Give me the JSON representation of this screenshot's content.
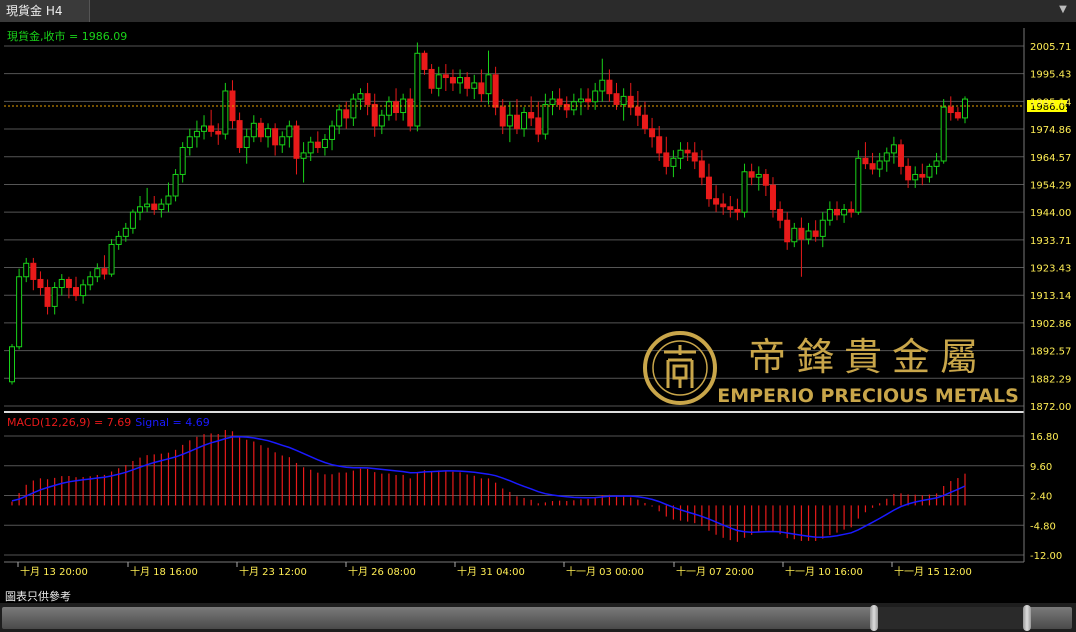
{
  "tab": {
    "label": "現貨金 H4"
  },
  "price_label": "現貨金,收市 = 1986.09",
  "macd_label": "MACD(12,26,9) = 7.69",
  "signal_label": "Signal = 4.69",
  "logo": {
    "chinese": "帝鋒貴金屬",
    "english": "EMPERIO PRECIOUS METALS"
  },
  "disclaimer": "圖表只供參考",
  "colors": {
    "up": "#19d219",
    "down": "#e81a1a",
    "signal": "#1a1aff",
    "macd_hist": "#e81a1a",
    "current_price_line": "#e8a000",
    "current_price_box": "#ffff00",
    "axis_text": "#ffee55",
    "logo": "#c9a64a"
  },
  "chart_data": [
    {
      "type": "candlestick",
      "title": "現貨金 H4",
      "close_label": "1986.09",
      "ylim": [
        1872.0,
        2010.0
      ],
      "y_ticks": [
        "2005.71",
        "1995.43",
        "1985.14",
        "1974.86",
        "1964.57",
        "1954.29",
        "1944.00",
        "1933.71",
        "1923.43",
        "1913.14",
        "1902.86",
        "1892.57",
        "1882.29",
        "1872.00"
      ],
      "x_ticks": [
        "十月 13 20:00",
        "十月 18 16:00",
        "十月 23 12:00",
        "十月 26 08:00",
        "十月 31 04:00",
        "十一月 03 00:00",
        "十一月 07 20:00",
        "十一月 10 16:00",
        "十一月 15 12:00"
      ],
      "grid": true,
      "candles": [
        [
          1881,
          1895,
          1880,
          1894
        ],
        [
          1894,
          1923,
          1893,
          1920
        ],
        [
          1920,
          1927,
          1918,
          1925
        ],
        [
          1925,
          1927,
          1915,
          1919
        ],
        [
          1919,
          1922,
          1913,
          1916
        ],
        [
          1916,
          1919,
          1906,
          1909
        ],
        [
          1909,
          1918,
          1906,
          1916
        ],
        [
          1916,
          1921,
          1913,
          1919
        ],
        [
          1919,
          1920,
          1912,
          1916
        ],
        [
          1916,
          1920,
          1911,
          1913
        ],
        [
          1913,
          1919,
          1910,
          1917
        ],
        [
          1917,
          1922,
          1915,
          1920
        ],
        [
          1920,
          1925,
          1918,
          1923
        ],
        [
          1923,
          1928,
          1919,
          1921
        ],
        [
          1921,
          1934,
          1920,
          1932
        ],
        [
          1932,
          1937,
          1930,
          1935
        ],
        [
          1935,
          1940,
          1933,
          1938
        ],
        [
          1938,
          1945,
          1936,
          1944
        ],
        [
          1944,
          1950,
          1941,
          1946
        ],
        [
          1946,
          1953,
          1944,
          1947
        ],
        [
          1947,
          1950,
          1943,
          1945
        ],
        [
          1945,
          1949,
          1942,
          1947
        ],
        [
          1947,
          1955,
          1944,
          1950
        ],
        [
          1950,
          1960,
          1948,
          1958
        ],
        [
          1958,
          1970,
          1955,
          1968
        ],
        [
          1968,
          1975,
          1965,
          1972
        ],
        [
          1972,
          1978,
          1968,
          1974
        ],
        [
          1974,
          1980,
          1971,
          1976
        ],
        [
          1976,
          1982,
          1972,
          1974
        ],
        [
          1974,
          1977,
          1969,
          1973
        ],
        [
          1973,
          1992,
          1971,
          1989
        ],
        [
          1989,
          1993,
          1975,
          1978
        ],
        [
          1978,
          1981,
          1966,
          1968
        ],
        [
          1968,
          1975,
          1962,
          1972
        ],
        [
          1972,
          1980,
          1970,
          1977
        ],
        [
          1977,
          1979,
          1970,
          1972
        ],
        [
          1972,
          1977,
          1968,
          1975
        ],
        [
          1975,
          1977,
          1965,
          1969
        ],
        [
          1969,
          1974,
          1966,
          1972
        ],
        [
          1972,
          1978,
          1968,
          1976
        ],
        [
          1976,
          1978,
          1958,
          1964
        ],
        [
          1964,
          1970,
          1955,
          1966
        ],
        [
          1966,
          1972,
          1963,
          1970
        ],
        [
          1970,
          1974,
          1966,
          1968
        ],
        [
          1968,
          1973,
          1965,
          1971
        ],
        [
          1971,
          1978,
          1967,
          1976
        ],
        [
          1976,
          1984,
          1973,
          1982
        ],
        [
          1982,
          1985,
          1975,
          1979
        ],
        [
          1979,
          1988,
          1976,
          1986
        ],
        [
          1986,
          1990,
          1982,
          1988
        ],
        [
          1988,
          1992,
          1980,
          1984
        ],
        [
          1984,
          1988,
          1972,
          1976
        ],
        [
          1976,
          1982,
          1973,
          1980
        ],
        [
          1980,
          1987,
          1978,
          1985
        ],
        [
          1985,
          1990,
          1978,
          1981
        ],
        [
          1981,
          1988,
          1978,
          1986
        ],
        [
          1986,
          1990,
          1974,
          1976
        ],
        [
          1976,
          2007,
          1974,
          2003
        ],
        [
          2003,
          2004,
          1995,
          1997
        ],
        [
          1997,
          1999,
          1988,
          1990
        ],
        [
          1990,
          1998,
          1987,
          1995
        ],
        [
          1995,
          1999,
          1989,
          1994
        ],
        [
          1994,
          1997,
          1989,
          1992
        ],
        [
          1992,
          1997,
          1988,
          1994
        ],
        [
          1994,
          1996,
          1987,
          1990
        ],
        [
          1990,
          1995,
          1986,
          1992
        ],
        [
          1992,
          1997,
          1985,
          1988
        ],
        [
          1988,
          2004,
          1984,
          1995
        ],
        [
          1995,
          1998,
          1980,
          1983
        ],
        [
          1983,
          1986,
          1973,
          1976
        ],
        [
          1976,
          1985,
          1970,
          1980
        ],
        [
          1980,
          1986,
          1973,
          1975
        ],
        [
          1975,
          1983,
          1972,
          1981
        ],
        [
          1981,
          1987,
          1976,
          1979
        ],
        [
          1979,
          1985,
          1970,
          1973
        ],
        [
          1973,
          1988,
          1971,
          1984
        ],
        [
          1984,
          1989,
          1980,
          1986
        ],
        [
          1986,
          1990,
          1982,
          1984
        ],
        [
          1984,
          1987,
          1979,
          1982
        ],
        [
          1982,
          1988,
          1980,
          1985
        ],
        [
          1985,
          1990,
          1980,
          1986
        ],
        [
          1986,
          1990,
          1982,
          1985
        ],
        [
          1985,
          1992,
          1982,
          1989
        ],
        [
          1989,
          2001,
          1985,
          1993
        ],
        [
          1993,
          1997,
          1985,
          1988
        ],
        [
          1988,
          1992,
          1982,
          1984
        ],
        [
          1984,
          1990,
          1978,
          1987
        ],
        [
          1987,
          1992,
          1980,
          1983
        ],
        [
          1983,
          1989,
          1976,
          1980
        ],
        [
          1980,
          1985,
          1973,
          1975
        ],
        [
          1975,
          1979,
          1968,
          1972
        ],
        [
          1972,
          1976,
          1963,
          1966
        ],
        [
          1966,
          1972,
          1958,
          1961
        ],
        [
          1961,
          1967,
          1957,
          1964
        ],
        [
          1964,
          1970,
          1960,
          1967
        ],
        [
          1967,
          1970,
          1963,
          1966
        ],
        [
          1966,
          1970,
          1960,
          1963
        ],
        [
          1963,
          1967,
          1954,
          1957
        ],
        [
          1957,
          1962,
          1946,
          1949
        ],
        [
          1949,
          1954,
          1944,
          1947
        ],
        [
          1947,
          1951,
          1943,
          1946
        ],
        [
          1946,
          1950,
          1942,
          1945
        ],
        [
          1945,
          1949,
          1941,
          1944
        ],
        [
          1944,
          1962,
          1942,
          1959
        ],
        [
          1959,
          1962,
          1954,
          1957
        ],
        [
          1957,
          1961,
          1952,
          1958
        ],
        [
          1958,
          1960,
          1950,
          1954
        ],
        [
          1954,
          1957,
          1942,
          1945
        ],
        [
          1945,
          1948,
          1938,
          1941
        ],
        [
          1941,
          1944,
          1930,
          1933
        ],
        [
          1933,
          1940,
          1931,
          1938
        ],
        [
          1938,
          1942,
          1920,
          1934
        ],
        [
          1934,
          1940,
          1932,
          1937
        ],
        [
          1937,
          1941,
          1933,
          1935
        ],
        [
          1935,
          1944,
          1931,
          1941
        ],
        [
          1941,
          1948,
          1939,
          1945
        ],
        [
          1945,
          1948,
          1941,
          1943
        ],
        [
          1943,
          1947,
          1940,
          1945
        ],
        [
          1945,
          1948,
          1942,
          1944
        ],
        [
          1944,
          1967,
          1943,
          1964
        ],
        [
          1964,
          1970,
          1960,
          1962
        ],
        [
          1962,
          1966,
          1958,
          1960
        ],
        [
          1960,
          1966,
          1957,
          1963
        ],
        [
          1963,
          1968,
          1959,
          1966
        ],
        [
          1966,
          1972,
          1962,
          1969
        ],
        [
          1969,
          1971,
          1958,
          1961
        ],
        [
          1961,
          1964,
          1953,
          1956
        ],
        [
          1956,
          1961,
          1953,
          1958
        ],
        [
          1958,
          1962,
          1954,
          1957
        ],
        [
          1957,
          1962,
          1955,
          1961
        ],
        [
          1961,
          1966,
          1958,
          1963
        ],
        [
          1963,
          1986,
          1962,
          1983
        ],
        [
          1983,
          1987,
          1978,
          1981
        ],
        [
          1981,
          1983,
          1978,
          1979
        ],
        [
          1979,
          1987,
          1977,
          1986
        ]
      ]
    },
    {
      "type": "bar",
      "title": "MACD(12,26,9)",
      "macd_value": 7.69,
      "signal_value": 4.69,
      "ylim": [
        -15.0,
        20.0
      ],
      "y_ticks": [
        "16.80",
        "9.60",
        "2.40",
        "-4.80",
        "-12.00"
      ],
      "series": [
        {
          "name": "MACD(12,26,9)",
          "values": []
        },
        {
          "name": "Signal",
          "values": []
        }
      ]
    }
  ]
}
